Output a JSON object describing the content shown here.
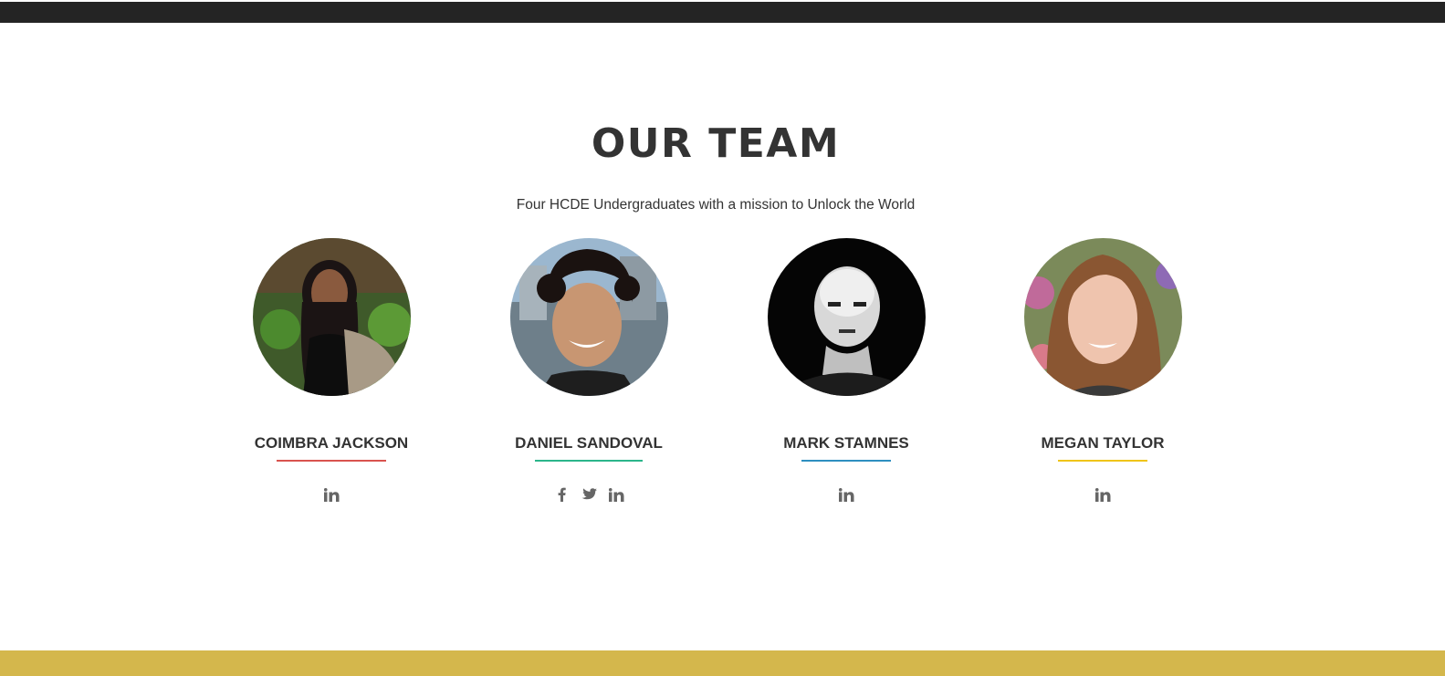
{
  "section": {
    "title": "OUR TEAM",
    "subtitle": "Four HCDE Undergraduates with a mission to Unlock the World"
  },
  "colors": {
    "top_bar": "#242424",
    "footer_bar": "#d4b74c",
    "text": "#333333",
    "icon": "#666666"
  },
  "members": [
    {
      "name": "COIMBRA JACKSON",
      "underline_color": "#d9534f",
      "socials": [
        "linkedin-icon"
      ]
    },
    {
      "name": "DANIEL SANDOVAL",
      "underline_color": "#2bb58b",
      "socials": [
        "facebook-icon",
        "twitter-icon",
        "linkedin-icon"
      ]
    },
    {
      "name": "MARK STAMNES",
      "underline_color": "#2e8fc0",
      "socials": [
        "linkedin-icon"
      ]
    },
    {
      "name": "MEGAN TAYLOR",
      "underline_color": "#f0c419",
      "socials": [
        "linkedin-icon"
      ]
    }
  ]
}
